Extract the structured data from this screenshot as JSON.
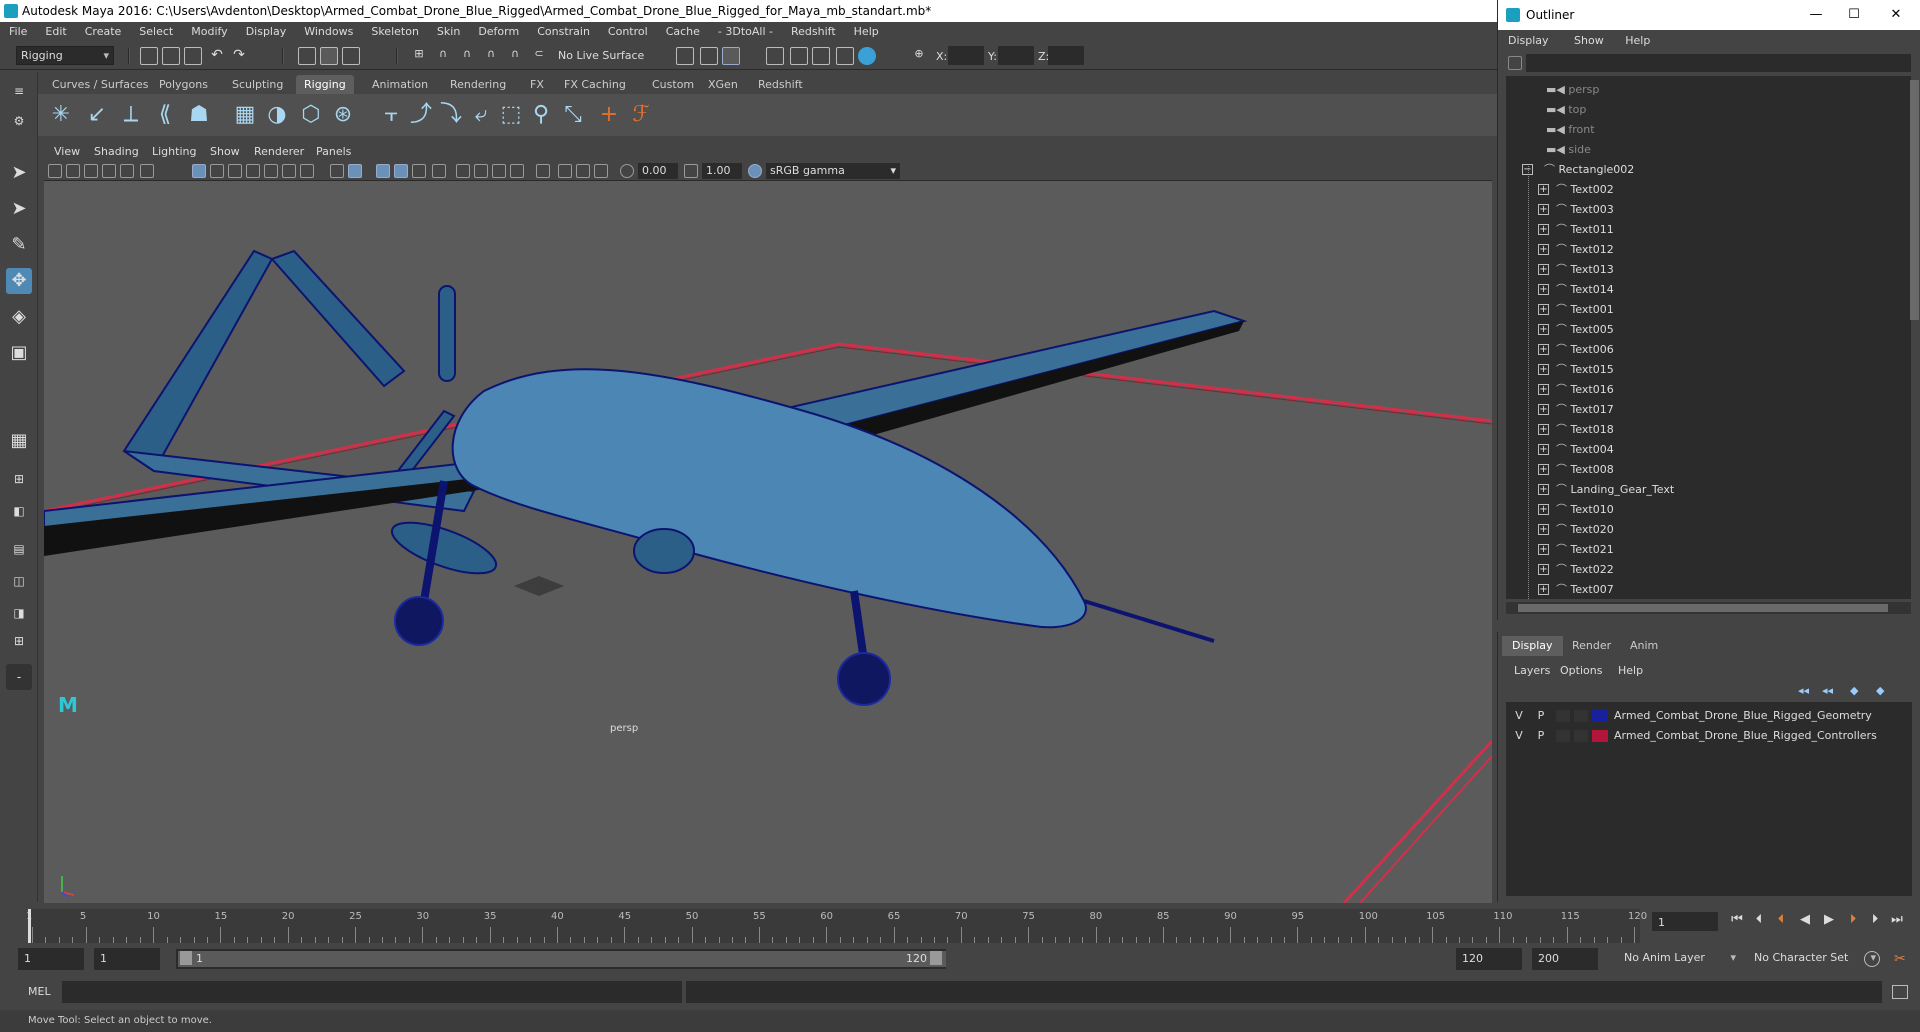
{
  "window": {
    "title": "Autodesk Maya 2016: C:\\Users\\Avdenton\\Desktop\\Armed_Combat_Drone_Blue_Rigged\\Armed_Combat_Drone_Blue_Rigged_for_Maya_mb_standart.mb*"
  },
  "menubar": [
    "File",
    "Edit",
    "Create",
    "Select",
    "Modify",
    "Display",
    "Windows",
    "Skeleton",
    "Skin",
    "Deform",
    "Constrain",
    "Control",
    "Cache",
    "- 3DtoAll -",
    "Redshift",
    "Help"
  ],
  "status_line": {
    "mode": "Rigging",
    "live_surface": "No Live Surface",
    "x_label": "X:",
    "y_label": "Y:",
    "z_label": "Z:"
  },
  "shelf_tabs": [
    "Curves / Surfaces",
    "Polygons",
    "Sculpting",
    "Rigging",
    "Animation",
    "Rendering",
    "FX",
    "FX Caching",
    "Custom",
    "XGen",
    "Redshift"
  ],
  "shelf_active": "Rigging",
  "viewport": {
    "menu": [
      "View",
      "Shading",
      "Lighting",
      "Show",
      "Renderer",
      "Panels"
    ],
    "exposure": "0.00",
    "gamma": "1.00",
    "color_space": "sRGB gamma",
    "camera_label": "persp"
  },
  "outliner": {
    "title": "Outliner",
    "menu": [
      "Display",
      "Show",
      "Help"
    ],
    "cameras": [
      "persp",
      "top",
      "front",
      "side"
    ],
    "root": "Rectangle002",
    "children": [
      "Text002",
      "Text003",
      "Text011",
      "Text012",
      "Text013",
      "Text014",
      "Text001",
      "Text005",
      "Text006",
      "Text015",
      "Text016",
      "Text017",
      "Text018",
      "Text004",
      "Text008",
      "Landing_Gear_Text",
      "Text010",
      "Text020",
      "Text021",
      "Text022",
      "Text007"
    ]
  },
  "layer_editor": {
    "tabs": [
      "Display",
      "Render",
      "Anim"
    ],
    "active_tab": "Display",
    "menu": [
      "Layers",
      "Options",
      "Help"
    ],
    "layers": [
      {
        "v": "V",
        "p": "P",
        "name": "Armed_Combat_Drone_Blue_Rigged_Geometry",
        "color": "#1a1f9c"
      },
      {
        "v": "V",
        "p": "P",
        "name": "Armed_Combat_Drone_Blue_Rigged_Controllers",
        "color": "#b3143a"
      }
    ]
  },
  "timeline": {
    "ticks": [
      "1",
      "5",
      "10",
      "15",
      "20",
      "25",
      "30",
      "35",
      "40",
      "45",
      "50",
      "55",
      "60",
      "65",
      "70",
      "75",
      "80",
      "85",
      "90",
      "95",
      "100",
      "105",
      "110",
      "115",
      "120"
    ],
    "current_frame": "1",
    "range_start": "1",
    "playback_start": "1",
    "slider_start": "1",
    "slider_end": "120",
    "playback_end": "120",
    "range_end": "200",
    "anim_layer": "No Anim Layer",
    "character_set": "No Character Set"
  },
  "command_line": {
    "label": "MEL"
  },
  "help_line": "Move Tool: Select an object to move.",
  "colors": {
    "accent": "#4f8ab5",
    "wire": "#1b2a9a",
    "grid_red": "#d0304a"
  }
}
